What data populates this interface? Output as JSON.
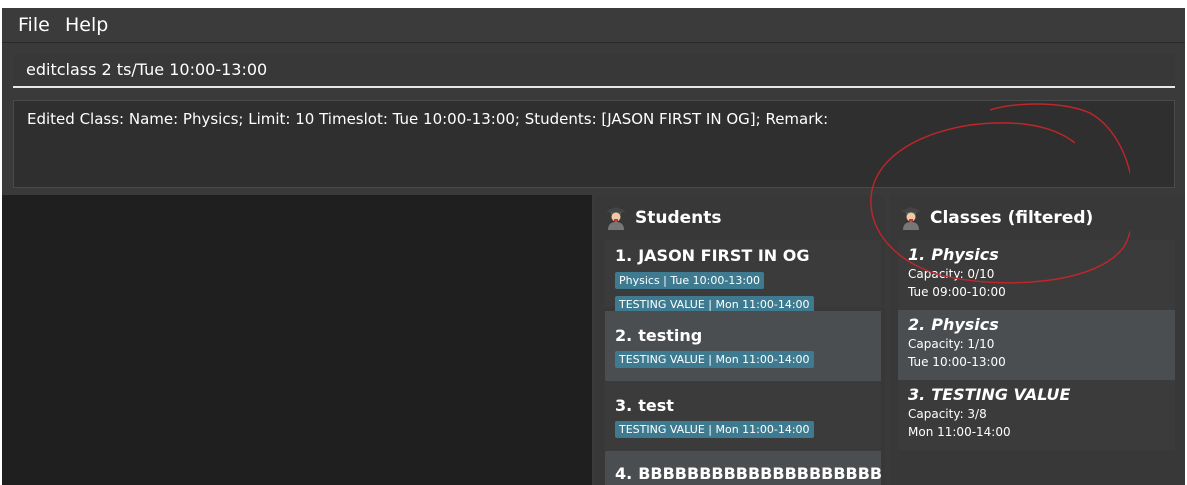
{
  "menu": {
    "file": "File",
    "help": "Help"
  },
  "command": {
    "value": "editclass 2 ts/Tue 10:00-13:00"
  },
  "result": {
    "text": "Edited Class: Name: Physics; Limit: 10 Timeslot: Tue 10:00-13:00; Students: [JASON FIRST IN OG]; Remark:"
  },
  "students": {
    "title": "Students",
    "icon": "student-icon",
    "items": [
      {
        "index": "1.",
        "name": "JASON FIRST IN OG",
        "tags": [
          "Physics | Tue 10:00-13:00",
          "TESTING VALUE | Mon 11:00-14:00"
        ]
      },
      {
        "index": "2.",
        "name": "testing",
        "tags": [
          "TESTING VALUE | Mon 11:00-14:00"
        ]
      },
      {
        "index": "3.",
        "name": "test",
        "tags": [
          "TESTING VALUE | Mon 11:00-14:00"
        ]
      },
      {
        "index": "4.",
        "name": "BBBBBBBBBBBBBBBBBBBB",
        "tags": []
      }
    ]
  },
  "classes": {
    "title": "Classes (filtered)",
    "icon": "student-icon",
    "items": [
      {
        "index": "1.",
        "name": "Physics",
        "capacity": "Capacity: 0/10",
        "timeslot": "Tue 09:00-10:00"
      },
      {
        "index": "2.",
        "name": "Physics",
        "capacity": "Capacity: 1/10",
        "timeslot": "Tue 10:00-13:00"
      },
      {
        "index": "3.",
        "name": "TESTING VALUE",
        "capacity": "Capacity: 3/8",
        "timeslot": "Mon 11:00-14:00"
      }
    ]
  },
  "colors": {
    "tag": "#3e7b91",
    "annotation": "#c0262a"
  }
}
